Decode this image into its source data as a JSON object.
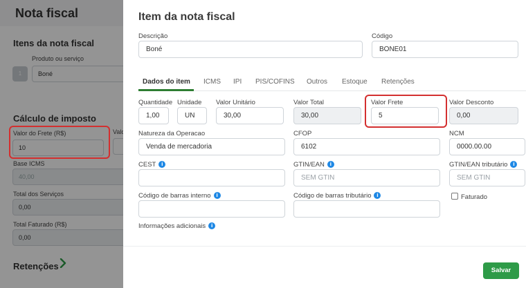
{
  "background": {
    "title": "Nota fiscal",
    "items_heading": "Itens da nota fiscal",
    "product_label": "Produto ou serviço",
    "product_index": "1",
    "product_value": "Boné",
    "tax_heading": "Cálculo de imposto",
    "freight_label": "Valor do Frete (R$)",
    "freight_value": "10",
    "truncated_label": "Valo",
    "base_icms_label": "Base ICMS",
    "base_icms_value": "40,00",
    "total_services_label": "Total dos Serviços",
    "total_services_value": "0,00",
    "total_billed_label": "Total Faturado (R$)",
    "total_billed_value": "0,00",
    "retentions_link": "Retenções"
  },
  "drawer": {
    "title": "Item da nota fiscal",
    "description_label": "Descrição",
    "description_value": "Boné",
    "code_label": "Código",
    "code_value": "BONE01",
    "tabs": [
      "Dados do item",
      "ICMS",
      "IPI",
      "PIS/COFINS",
      "Outros",
      "Estoque",
      "Retenções"
    ],
    "quantity_label": "Quantidade",
    "quantity_value": "1,00",
    "unit_label": "Unidade",
    "unit_value": "UN",
    "unit_price_label": "Valor Unitário",
    "unit_price_value": "30,00",
    "total_value_label": "Valor Total",
    "total_value_value": "30,00",
    "freight_label": "Valor Frete",
    "freight_value": "5",
    "discount_label": "Valor Desconto",
    "discount_value": "0,00",
    "operation_label": "Natureza da Operacao",
    "operation_value": "Venda de mercadoria",
    "cfop_label": "CFOP",
    "cfop_value": "6102",
    "ncm_label": "NCM",
    "ncm_value": "0000.00.00",
    "cest_label": "CEST",
    "gtin_label": "GTIN/EAN",
    "gtin_placeholder": "SEM GTIN",
    "gtin_tax_label": "GTIN/EAN tributário",
    "gtin_tax_placeholder": "SEM GTIN",
    "barcode_internal_label": "Código de barras interno",
    "barcode_tax_label": "Código de barras tributário",
    "billed_checkbox_label": "Faturado",
    "additional_info_label": "Informações adicionais",
    "save_label": "Salvar",
    "info_icon_glyph": "i"
  },
  "colors": {
    "accent": "#2e9b48",
    "highlight": "#d32f2f",
    "info": "#1e88e5"
  }
}
